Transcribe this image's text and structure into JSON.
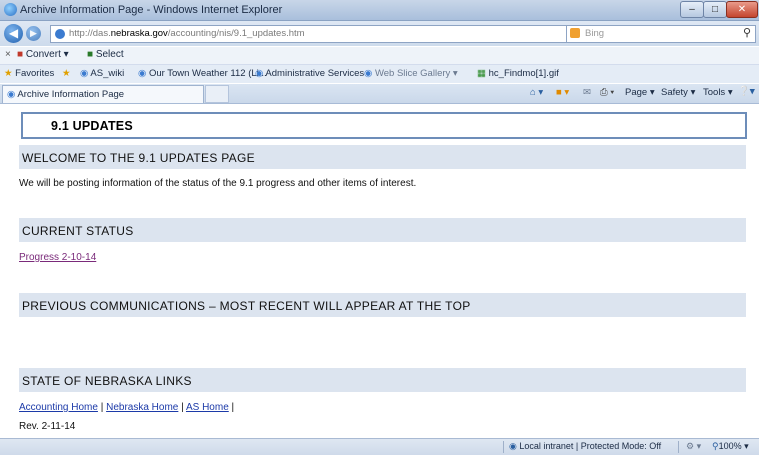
{
  "window": {
    "title": "Archive Information Page - Windows Internet Explorer"
  },
  "address": {
    "url_prefix": "http://das.",
    "url_domain": "nebraska.gov",
    "url_path": "/accounting/nis/9.1_updates.htm",
    "search_placeholder": "Bing"
  },
  "command_bar": {
    "convert_label": "Convert",
    "select_label": "Select"
  },
  "favorites_bar": {
    "favorites_label": "Favorites",
    "items": [
      "AS_wiki",
      "Our Town Weather 112 (Li...",
      "Administrative Services",
      "Web Slice Gallery",
      "hc_Findmo[1].gif"
    ]
  },
  "tab": {
    "title": "Archive Information Page"
  },
  "toolbar": {
    "page_label": "Page",
    "safety_label": "Safety",
    "tools_label": "Tools"
  },
  "page": {
    "header": "9.1 UPDATES",
    "sections": [
      {
        "heading": "WELCOME TO THE 9.1 UPDATES PAGE"
      },
      {
        "heading": "CURRENT STATUS"
      },
      {
        "heading": "PREVIOUS COMMUNICATIONS – MOST RECENT WILL APPEAR AT THE TOP"
      },
      {
        "heading": "STATE OF NEBRASKA LINKS"
      }
    ],
    "welcome_text": "We will be posting information of the status of the 9.1 progress and other items of interest.",
    "progress_link": "Progress 2-10-14",
    "links": [
      "Accounting Home",
      "Nebraska Home",
      "AS Home"
    ],
    "link_separator": " | ",
    "revision": "Rev. 2-11-14"
  },
  "status_bar": {
    "zone": "Local intranet | Protected Mode: Off",
    "zoom": "100%"
  }
}
